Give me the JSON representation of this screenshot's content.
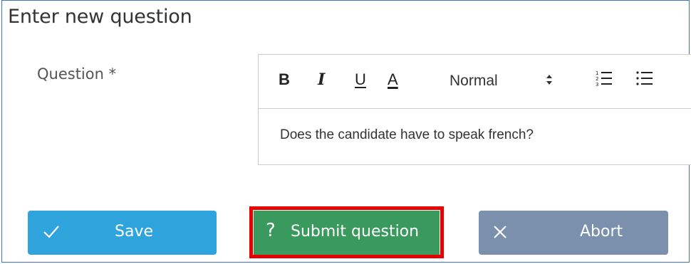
{
  "form": {
    "heading": "Enter new question",
    "question_label": "Question *"
  },
  "editor": {
    "toolbar": {
      "bold": "B",
      "italic": "I",
      "underline": "U",
      "color": "A",
      "header_select": "Normal",
      "header_caret": "↕"
    },
    "content": "Does the candidate have to speak french?"
  },
  "buttons": {
    "save": {
      "label": "Save",
      "icon": "check-icon",
      "color": "#2ea3dc"
    },
    "submit": {
      "label": "Submit question",
      "icon": "?",
      "color": "#3a9a5e",
      "highlight": "#e60000"
    },
    "abort": {
      "label": "Abort",
      "icon": "close-icon",
      "color": "#7b90ad"
    }
  }
}
